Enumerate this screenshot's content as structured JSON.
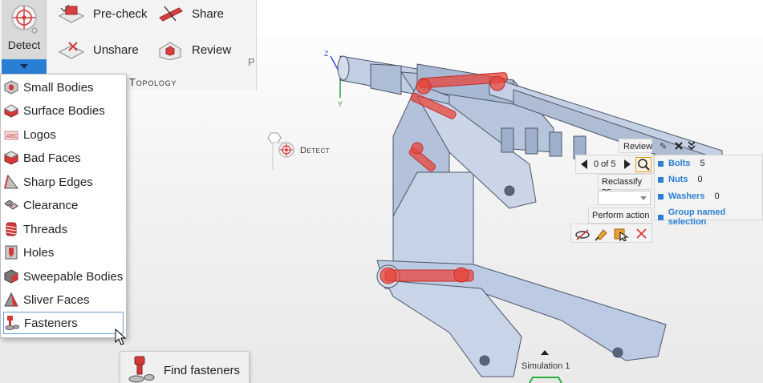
{
  "ribbon": {
    "detect_label": "Detect",
    "precheck_label": "Pre-check",
    "share_label": "Share",
    "unshare_label": "Unshare",
    "review_label": "Review",
    "group_label": "e Topology",
    "stub_label": "P"
  },
  "dropdown": {
    "items": [
      {
        "label": "Small Bodies",
        "icon": "small-bodies-icon"
      },
      {
        "label": "Surface Bodies",
        "icon": "surface-bodies-icon"
      },
      {
        "label": "Logos",
        "icon": "logos-icon"
      },
      {
        "label": "Bad Faces",
        "icon": "bad-faces-icon"
      },
      {
        "label": "Sharp Edges",
        "icon": "sharp-edges-icon"
      },
      {
        "label": "Clearance",
        "icon": "clearance-icon"
      },
      {
        "label": "Threads",
        "icon": "threads-icon"
      },
      {
        "label": "Holes",
        "icon": "holes-icon"
      },
      {
        "label": "Sweepable Bodies",
        "icon": "sweepable-bodies-icon"
      },
      {
        "label": "Sliver Faces",
        "icon": "sliver-faces-icon"
      },
      {
        "label": "Fasteners",
        "icon": "fasteners-icon"
      }
    ],
    "selected_index": 10
  },
  "tooltip": {
    "label": "Find fasteners"
  },
  "detect_node": {
    "label": "Detect"
  },
  "axes": {
    "x": "X",
    "y": "Y",
    "z": "Z"
  },
  "review_panel": {
    "review_label": "Review",
    "counter": "0 of 5",
    "reclassify_label": "Reclassify as",
    "perform_label": "Perform action",
    "stats": [
      {
        "label": "Bolts",
        "value": "5"
      },
      {
        "label": "Nuts",
        "value": "0"
      },
      {
        "label": "Washers",
        "value": "0"
      },
      {
        "label": "Group named selection",
        "value": ""
      }
    ]
  },
  "simulation_label": "Simulation 1",
  "colors": {
    "accent": "#2a7fd4",
    "part": "#bccbe3",
    "fastener": "#e8453c"
  }
}
